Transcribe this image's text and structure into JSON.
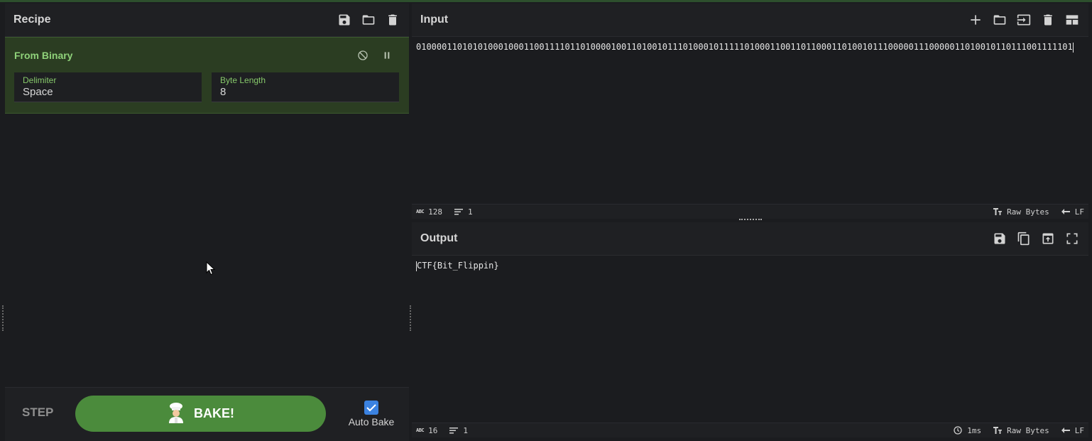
{
  "recipe": {
    "title": "Recipe",
    "icons": [
      "save-icon",
      "folder-icon",
      "trash-icon"
    ],
    "operation": {
      "name": "From Binary",
      "delimiter_label": "Delimiter",
      "delimiter_value": "Space",
      "byte_length_label": "Byte Length",
      "byte_length_value": "8"
    },
    "footer": {
      "step_label": "STEP",
      "bake_label": "BAKE!",
      "auto_bake_label": "Auto Bake",
      "auto_bake_checked": true
    }
  },
  "input": {
    "title": "Input",
    "text": "01000011010101000100011001111011010000100110100101110100010111110100011001101100011010010111000001110000011010010110111001111101",
    "status": {
      "length": "128",
      "lines": "1",
      "encoding": "Raw Bytes",
      "eol": "LF"
    }
  },
  "output": {
    "title": "Output",
    "text": "CTF{Bit_Flippin}",
    "status": {
      "length": "16",
      "lines": "1",
      "time": "1ms",
      "encoding": "Raw Bytes",
      "eol": "LF"
    }
  },
  "colors": {
    "accent_green": "#4b8b3c",
    "operation_bg": "#2b3d22",
    "label_green": "#86c86a",
    "checkbox_blue": "#3b82e0"
  }
}
